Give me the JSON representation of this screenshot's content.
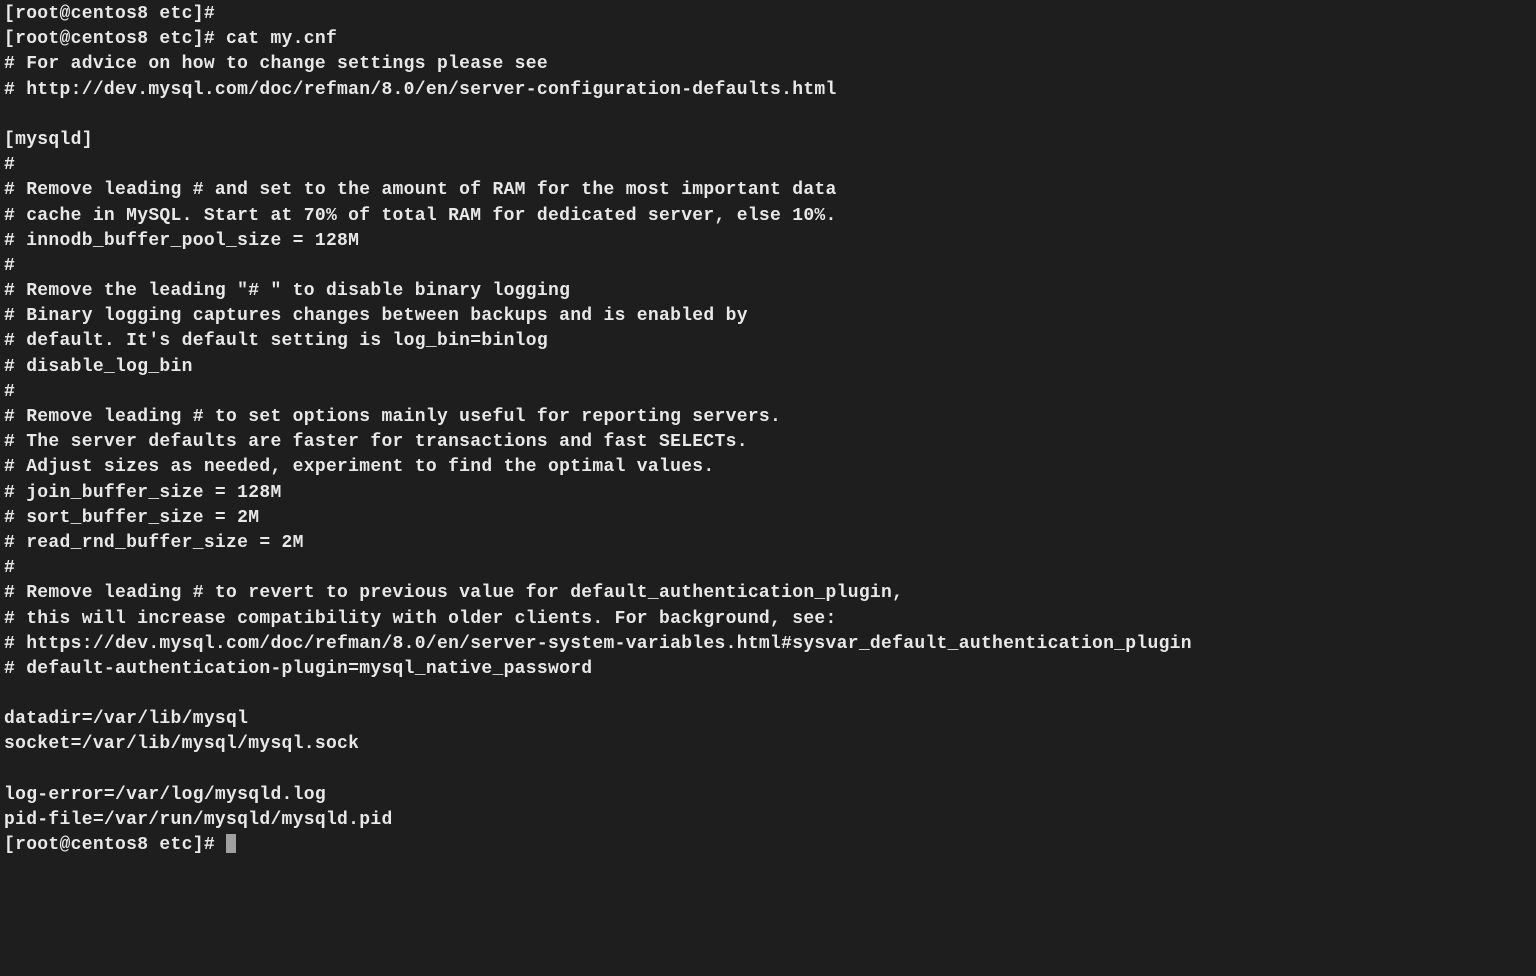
{
  "terminal": {
    "lines": [
      "[root@centos8 etc]#",
      "[root@centos8 etc]# cat my.cnf",
      "# For advice on how to change settings please see",
      "# http://dev.mysql.com/doc/refman/8.0/en/server-configuration-defaults.html",
      "",
      "[mysqld]",
      "#",
      "# Remove leading # and set to the amount of RAM for the most important data",
      "# cache in MySQL. Start at 70% of total RAM for dedicated server, else 10%.",
      "# innodb_buffer_pool_size = 128M",
      "#",
      "# Remove the leading \"# \" to disable binary logging",
      "# Binary logging captures changes between backups and is enabled by",
      "# default. It's default setting is log_bin=binlog",
      "# disable_log_bin",
      "#",
      "# Remove leading # to set options mainly useful for reporting servers.",
      "# The server defaults are faster for transactions and fast SELECTs.",
      "# Adjust sizes as needed, experiment to find the optimal values.",
      "# join_buffer_size = 128M",
      "# sort_buffer_size = 2M",
      "# read_rnd_buffer_size = 2M",
      "#",
      "# Remove leading # to revert to previous value for default_authentication_plugin,",
      "# this will increase compatibility with older clients. For background, see:",
      "# https://dev.mysql.com/doc/refman/8.0/en/server-system-variables.html#sysvar_default_authentication_plugin",
      "# default-authentication-plugin=mysql_native_password",
      "",
      "datadir=/var/lib/mysql",
      "socket=/var/lib/mysql/mysql.sock",
      "",
      "log-error=/var/log/mysqld.log",
      "pid-file=/var/run/mysqld/mysqld.pid"
    ],
    "prompt": "[root@centos8 etc]# "
  }
}
